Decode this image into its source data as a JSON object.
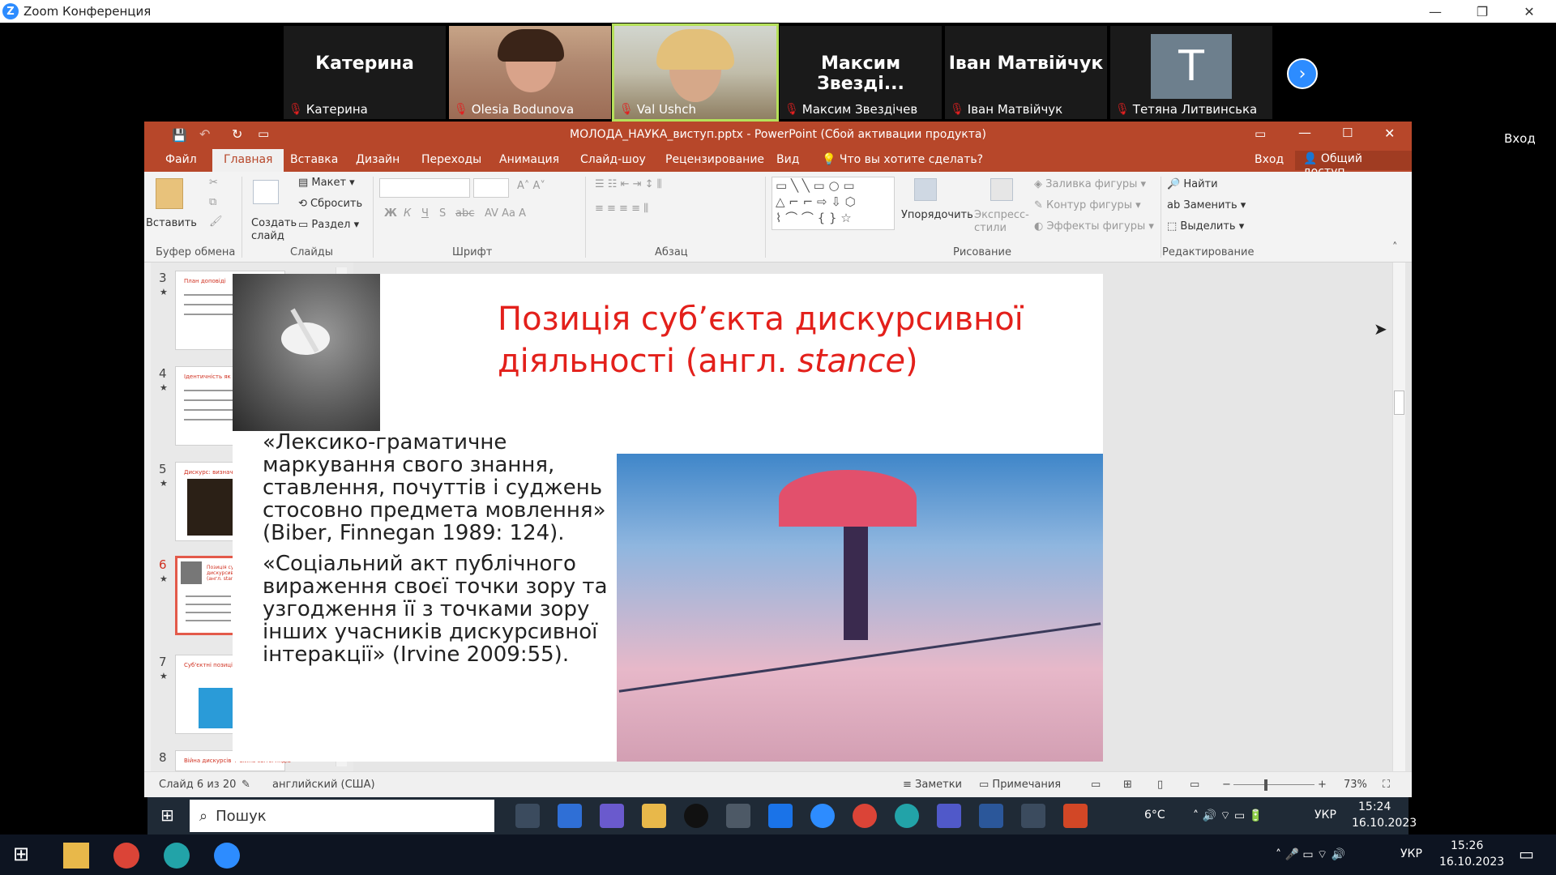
{
  "zoom": {
    "window_title": "Zoom Конференция",
    "controls": {
      "minimize": "—",
      "restore": "❐",
      "close": "✕"
    },
    "participants": [
      {
        "name": "Катерина",
        "display_name": "Катерина",
        "video": false
      },
      {
        "name": "Olesia Bodunova",
        "video": true
      },
      {
        "name": "Val Ushch",
        "video": true
      },
      {
        "name": "Максим Звезді...",
        "display_name": "Максим Звездічев",
        "video": false
      },
      {
        "name": "Іван Матвійчук",
        "display_name": "Іван Матвійчук",
        "video": false
      },
      {
        "name": "Тетяна Литвинська",
        "avatar_letter": "T",
        "video": false
      }
    ],
    "next_icon": "chevron-right-icon",
    "signin_label": "Вход"
  },
  "ppt": {
    "title": "МОЛОДА_НАУКА_виступ.pptx - PowerPoint (Сбой активации продукта)",
    "tabs": [
      "Файл",
      "Главная",
      "Вставка",
      "Дизайн",
      "Переходы",
      "Анимация",
      "Слайд-шоу",
      "Рецензирование",
      "Вид"
    ],
    "active_tab": "Главная",
    "tell_me": "Что вы хотите сделать?",
    "signin": "Вход",
    "share": "Общий доступ",
    "ribbon": {
      "clipboard": {
        "paste": "Вставить",
        "label": "Буфер обмена"
      },
      "slides": {
        "new_slide": "Создать слайд",
        "layout": "Макет",
        "reset": "Сбросить",
        "section": "Раздел",
        "label": "Слайды"
      },
      "font": {
        "label": "Шрифт",
        "bold": "Ж",
        "italic": "К",
        "underline": "Ч",
        "shadow": "S",
        "strike": "abc"
      },
      "paragraph": {
        "label": "Абзац"
      },
      "drawing": {
        "arrange": "Упорядочить",
        "quick_styles": "Экспресс-стили",
        "shape_fill": "Заливка фигуры",
        "shape_outline": "Контур фигуры",
        "shape_effects": "Эффекты фигуры",
        "label": "Рисование"
      },
      "editing": {
        "find": "Найти",
        "replace": "Заменить",
        "select": "Выделить",
        "label": "Редактирование"
      }
    },
    "thumbnails": [
      {
        "num": "3",
        "title": "План доповіді"
      },
      {
        "num": "4",
        "title": "Ідентичність як дискурсивний конструкт"
      },
      {
        "num": "5",
        "title": "Дискурс: визначення, завдання в житті"
      },
      {
        "num": "6",
        "title": "Позиція суб'єкта дискурсивної діяльності (англ. stance)",
        "selected": true
      },
      {
        "num": "7",
        "title": "Суб'єктні позиції та ідентичність"
      },
      {
        "num": "8",
        "title": "Війна дискурсів + війна світоглядів"
      }
    ],
    "slide": {
      "title_line1": "Позиція суб’єкта дискурсивної",
      "title_line2_a": "діяльності (англ. ",
      "title_line2_b": "stance",
      "title_line2_c": ")",
      "quote1": "«Лексико-граматичне маркування свого знання, ставлення, почуттів і суджень стосовно предмета мовлення» (Biber, Finnegan 1989: 124).",
      "quote2": "«Соціальний акт публічного вираження своєї точки зору та узгодження її з точками зору інших учасників дискурсивної інтеракції» (Irvine 2009:55)."
    },
    "status": {
      "slide_of": "Слайд 6 из 20",
      "language": "английский (США)",
      "notes": "Заметки",
      "comments": "Примечания",
      "zoom": "73%"
    }
  },
  "inner_taskbar": {
    "search_placeholder": "Пошук",
    "weather": "6°C",
    "lang": "УКР",
    "time": "15:24",
    "date": "16.10.2023"
  },
  "outer_taskbar": {
    "lang": "УКР",
    "time": "15:26",
    "date": "16.10.2023"
  },
  "colors": {
    "ppt_accent": "#b7472a",
    "zoom_blue": "#2d8cff",
    "slide_title": "#e3201b"
  }
}
